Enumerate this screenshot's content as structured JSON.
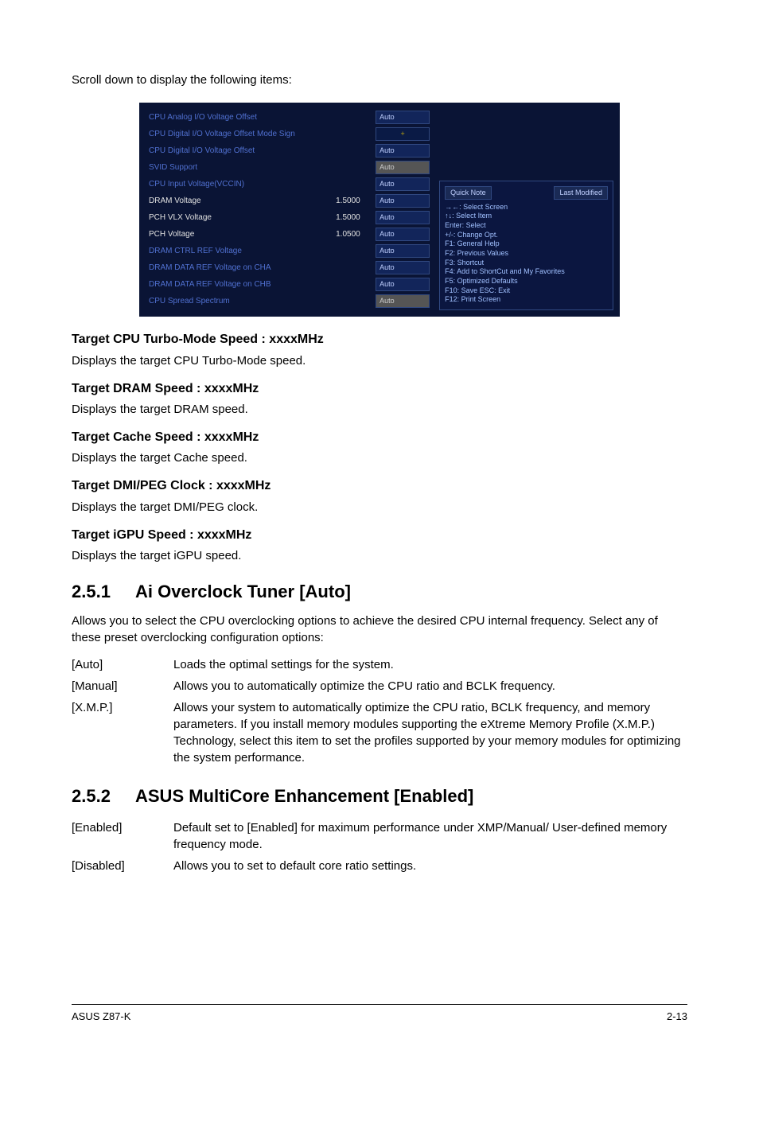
{
  "intro": "Scroll down to display the following items:",
  "bios": {
    "rows": [
      {
        "label": "CPU Analog I/O Voltage Offset",
        "val": "",
        "dd": "Auto",
        "hl": false
      },
      {
        "label": "CPU Digital I/O Voltage Offset Mode Sign",
        "val": "",
        "dd": "+",
        "hl": false,
        "minus": true
      },
      {
        "label": "CPU Digital I/O Voltage Offset",
        "val": "",
        "dd": "Auto",
        "hl": false
      },
      {
        "label": "SVID Support",
        "val": "",
        "dd": "Auto",
        "hl": false,
        "grey": true
      },
      {
        "label": "CPU Input Voltage(VCCIN)",
        "val": "",
        "dd": "Auto",
        "hl": false
      },
      {
        "label": "DRAM Voltage",
        "val": "1.5000",
        "dd": "Auto",
        "hl": true
      },
      {
        "label": "PCH VLX Voltage",
        "val": "1.5000",
        "dd": "Auto",
        "hl": true
      },
      {
        "label": "PCH Voltage",
        "val": "1.0500",
        "dd": "Auto",
        "hl": true
      },
      {
        "label": "DRAM CTRL REF Voltage",
        "val": "",
        "dd": "Auto",
        "hl": false
      },
      {
        "label": "DRAM DATA REF Voltage on CHA",
        "val": "",
        "dd": "Auto",
        "hl": false
      },
      {
        "label": "DRAM DATA REF Voltage on CHB",
        "val": "",
        "dd": "Auto",
        "hl": false
      },
      {
        "label": "CPU Spread Spectrum",
        "val": "",
        "dd": "Auto",
        "hl": false,
        "grey": true
      }
    ],
    "nav_header": {
      "left": "Quick Note",
      "right": "Last Modified"
    },
    "nav_lines": [
      "→←: Select Screen",
      "↑↓: Select Item",
      "Enter: Select",
      "+/-: Change Opt.",
      "F1: General Help",
      "F2: Previous Values",
      "F3: Shortcut",
      "F4: Add to ShortCut and My Favorites",
      "F5: Optimized Defaults",
      "F10: Save  ESC: Exit",
      "F12: Print Screen"
    ]
  },
  "targets": [
    {
      "h": "Target CPU Turbo-Mode Speed : xxxxMHz",
      "d": "Displays the target CPU Turbo-Mode speed."
    },
    {
      "h": "Target DRAM Speed : xxxxMHz",
      "d": "Displays the target DRAM speed."
    },
    {
      "h": "Target Cache Speed : xxxxMHz",
      "d": "Displays the target Cache speed."
    },
    {
      "h": "Target DMI/PEG Clock : xxxxMHz",
      "d": "Displays the target DMI/PEG clock."
    },
    {
      "h": "Target iGPU Speed : xxxxMHz",
      "d": "Displays the target iGPU speed."
    }
  ],
  "section1": {
    "num": "2.5.1",
    "title": "Ai Overclock Tuner [Auto]",
    "desc": "Allows you to select the CPU overclocking options to achieve the desired CPU internal frequency. Select any of these preset overclocking configuration options:",
    "opts": [
      {
        "k": "[Auto]",
        "v": "Loads the optimal settings for the system."
      },
      {
        "k": "[Manual]",
        "v": "Allows you to automatically optimize the CPU ratio and BCLK frequency."
      },
      {
        "k": "[X.M.P.]",
        "v": "Allows your system to automatically optimize the CPU ratio, BCLK frequency, and memory parameters. If you install memory modules supporting the eXtreme Memory Profile (X.M.P.) Technology, select this item to set the profiles supported by your memory modules for optimizing the system performance."
      }
    ]
  },
  "section2": {
    "num": "2.5.2",
    "title": "ASUS MultiCore Enhancement [Enabled]",
    "opts": [
      {
        "k": "[Enabled]",
        "v": "Default set to [Enabled] for maximum performance under XMP/Manual/ User-defined memory frequency mode."
      },
      {
        "k": "[Disabled]",
        "v": "Allows you to set to default core ratio settings."
      }
    ]
  },
  "footer": {
    "left": "ASUS Z87-K",
    "right": "2-13"
  }
}
